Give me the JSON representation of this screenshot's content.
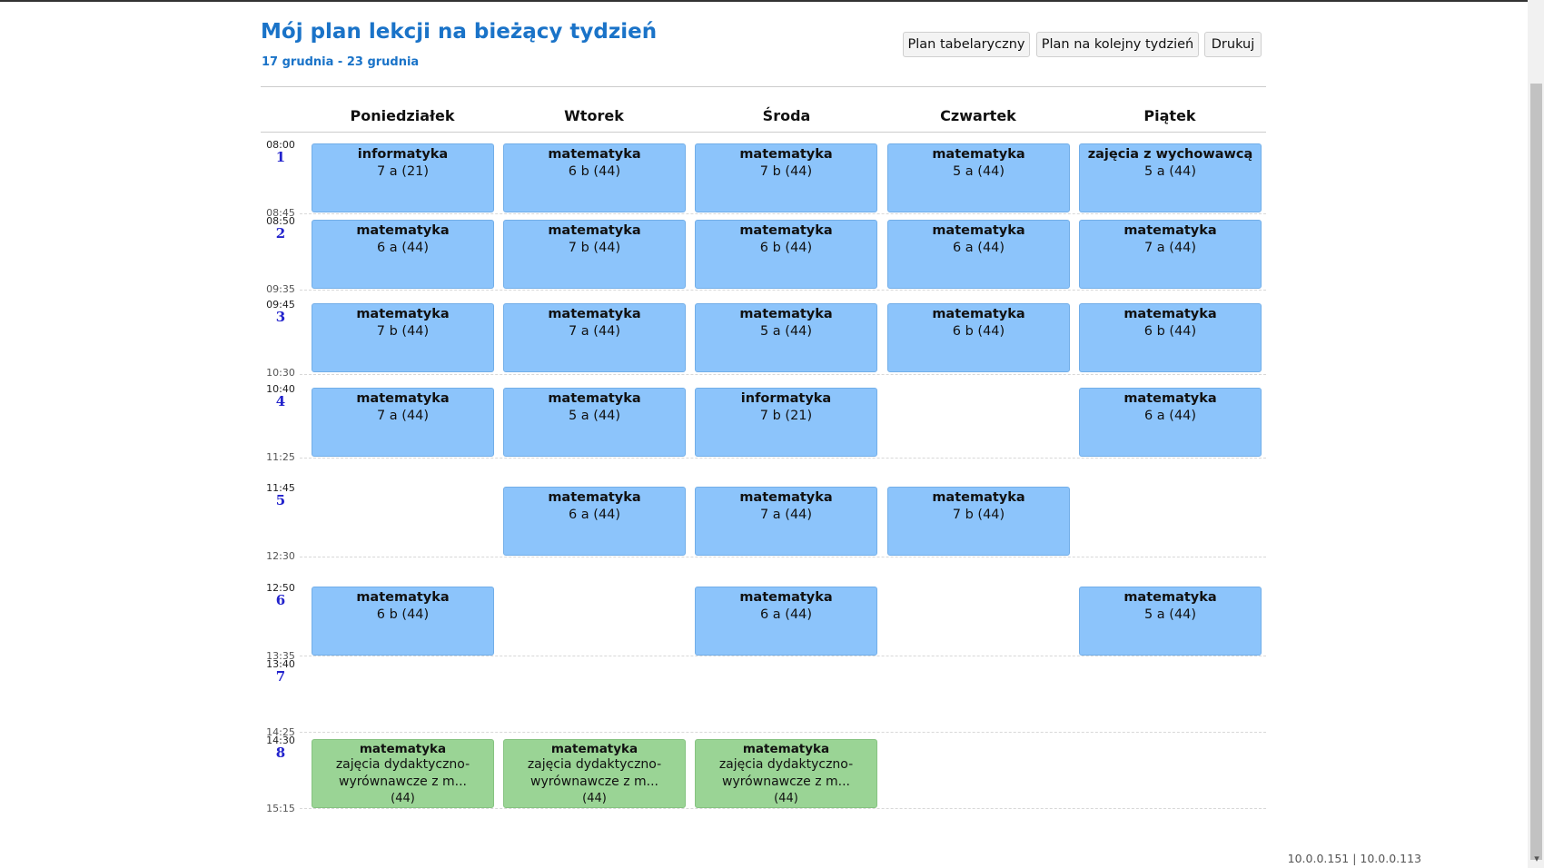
{
  "header": {
    "title": "Mój plan lekcji na bieżący tydzień",
    "date_range": "17 grudnia - 23 grudnia"
  },
  "buttons": {
    "table_view": "Plan tabelaryczny",
    "next_week": "Plan na kolejny tydzień",
    "print": "Drukuj"
  },
  "days": [
    "Poniedziałek",
    "Wtorek",
    "Środa",
    "Czwartek",
    "Piątek"
  ],
  "periods": [
    {
      "num": "1",
      "start": "08:00",
      "end": "08:45"
    },
    {
      "num": "2",
      "start": "08:50",
      "end": "09:35"
    },
    {
      "num": "3",
      "start": "09:45",
      "end": "10:30"
    },
    {
      "num": "4",
      "start": "10:40",
      "end": "11:25"
    },
    {
      "num": "5",
      "start": "11:45",
      "end": "12:30"
    },
    {
      "num": "6",
      "start": "12:50",
      "end": "13:35"
    },
    {
      "num": "7",
      "start": "13:40",
      "end": "14:25"
    },
    {
      "num": "8",
      "start": "14:30",
      "end": "15:15"
    }
  ],
  "lessons": [
    {
      "day": 0,
      "period": 0,
      "subject": "informatyka",
      "class": "7 a (21)"
    },
    {
      "day": 1,
      "period": 0,
      "subject": "matematyka",
      "class": "6 b (44)"
    },
    {
      "day": 2,
      "period": 0,
      "subject": "matematyka",
      "class": "7 b (44)"
    },
    {
      "day": 3,
      "period": 0,
      "subject": "matematyka",
      "class": "5 a (44)"
    },
    {
      "day": 4,
      "period": 0,
      "subject": "zajęcia z wychowawcą",
      "class": "5 a (44)"
    },
    {
      "day": 0,
      "period": 1,
      "subject": "matematyka",
      "class": "6 a (44)"
    },
    {
      "day": 1,
      "period": 1,
      "subject": "matematyka",
      "class": "7 b (44)"
    },
    {
      "day": 2,
      "period": 1,
      "subject": "matematyka",
      "class": "6 b (44)"
    },
    {
      "day": 3,
      "period": 1,
      "subject": "matematyka",
      "class": "6 a (44)"
    },
    {
      "day": 4,
      "period": 1,
      "subject": "matematyka",
      "class": "7 a (44)"
    },
    {
      "day": 0,
      "period": 2,
      "subject": "matematyka",
      "class": "7 b (44)"
    },
    {
      "day": 1,
      "period": 2,
      "subject": "matematyka",
      "class": "7 a (44)"
    },
    {
      "day": 2,
      "period": 2,
      "subject": "matematyka",
      "class": "5 a (44)"
    },
    {
      "day": 3,
      "period": 2,
      "subject": "matematyka",
      "class": "6 b (44)"
    },
    {
      "day": 4,
      "period": 2,
      "subject": "matematyka",
      "class": "6 b (44)"
    },
    {
      "day": 0,
      "period": 3,
      "subject": "matematyka",
      "class": "7 a (44)"
    },
    {
      "day": 1,
      "period": 3,
      "subject": "matematyka",
      "class": "5 a (44)"
    },
    {
      "day": 2,
      "period": 3,
      "subject": "informatyka",
      "class": "7 b (21)"
    },
    {
      "day": 4,
      "period": 3,
      "subject": "matematyka",
      "class": "6 a (44)"
    },
    {
      "day": 1,
      "period": 4,
      "subject": "matematyka",
      "class": "6 a (44)"
    },
    {
      "day": 2,
      "period": 4,
      "subject": "matematyka",
      "class": "7 a (44)"
    },
    {
      "day": 3,
      "period": 4,
      "subject": "matematyka",
      "class": "7 b (44)"
    },
    {
      "day": 0,
      "period": 5,
      "subject": "matematyka",
      "class": "6 b (44)"
    },
    {
      "day": 2,
      "period": 5,
      "subject": "matematyka",
      "class": "6 a (44)"
    },
    {
      "day": 4,
      "period": 5,
      "subject": "matematyka",
      "class": "5 a (44)"
    }
  ],
  "extra_lessons": [
    {
      "day": 0,
      "period": 7,
      "subject": "matematyka",
      "description": "zajęcia dydaktyczno-wyrównawcze z m...",
      "count": "(44)"
    },
    {
      "day": 1,
      "period": 7,
      "subject": "matematyka",
      "description": "zajęcia dydaktyczno-wyrównawcze z m...",
      "count": "(44)"
    },
    {
      "day": 2,
      "period": 7,
      "subject": "matematyka",
      "description": "zajęcia dydaktyczno-wyrównawcze z m...",
      "count": "(44)"
    }
  ],
  "footer": {
    "ip_info": "10.0.0.151 | 10.0.0.113"
  },
  "colors": {
    "title": "#1a73c8",
    "lesson": "#8cc4fb",
    "extra_lesson": "#9ad495",
    "period_number": "#2222cc"
  }
}
